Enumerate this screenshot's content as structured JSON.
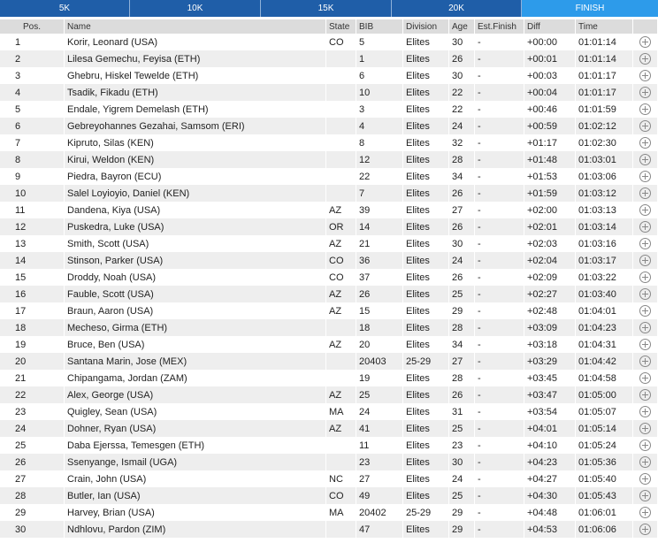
{
  "tabs": [
    {
      "label": "5K",
      "active": false
    },
    {
      "label": "10K",
      "active": false
    },
    {
      "label": "15K",
      "active": false
    },
    {
      "label": "20K",
      "active": false
    },
    {
      "label": "FINISH",
      "active": true
    }
  ],
  "columns": [
    "Pos.",
    "Name",
    "State",
    "BIB",
    "Division",
    "Age",
    "Est.Finish",
    "Diff",
    "Time",
    ""
  ],
  "rows": [
    [
      "1",
      "Korir, Leonard (USA)",
      "CO",
      "5",
      "Elites",
      "30",
      "-",
      "+00:00",
      "01:01:14"
    ],
    [
      "2",
      "Lilesa Gemechu, Feyisa (ETH)",
      "",
      "1",
      "Elites",
      "26",
      "-",
      "+00:01",
      "01:01:14"
    ],
    [
      "3",
      "Ghebru, Hiskel Tewelde (ETH)",
      "",
      "6",
      "Elites",
      "30",
      "-",
      "+00:03",
      "01:01:17"
    ],
    [
      "4",
      "Tsadik, Fikadu (ETH)",
      "",
      "10",
      "Elites",
      "22",
      "-",
      "+00:04",
      "01:01:17"
    ],
    [
      "5",
      "Endale, Yigrem Demelash (ETH)",
      "",
      "3",
      "Elites",
      "22",
      "-",
      "+00:46",
      "01:01:59"
    ],
    [
      "6",
      "Gebreyohannes Gezahai, Samsom (ERI)",
      "",
      "4",
      "Elites",
      "24",
      "-",
      "+00:59",
      "01:02:12"
    ],
    [
      "7",
      "Kipruto, Silas (KEN)",
      "",
      "8",
      "Elites",
      "32",
      "-",
      "+01:17",
      "01:02:30"
    ],
    [
      "8",
      "Kirui, Weldon (KEN)",
      "",
      "12",
      "Elites",
      "28",
      "-",
      "+01:48",
      "01:03:01"
    ],
    [
      "9",
      "Piedra, Bayron (ECU)",
      "",
      "22",
      "Elites",
      "34",
      "-",
      "+01:53",
      "01:03:06"
    ],
    [
      "10",
      "Salel Loyioyio, Daniel (KEN)",
      "",
      "7",
      "Elites",
      "26",
      "-",
      "+01:59",
      "01:03:12"
    ],
    [
      "11",
      "Dandena, Kiya (USA)",
      "AZ",
      "39",
      "Elites",
      "27",
      "-",
      "+02:00",
      "01:03:13"
    ],
    [
      "12",
      "Puskedra, Luke (USA)",
      "OR",
      "14",
      "Elites",
      "26",
      "-",
      "+02:01",
      "01:03:14"
    ],
    [
      "13",
      "Smith, Scott (USA)",
      "AZ",
      "21",
      "Elites",
      "30",
      "-",
      "+02:03",
      "01:03:16"
    ],
    [
      "14",
      "Stinson, Parker (USA)",
      "CO",
      "36",
      "Elites",
      "24",
      "-",
      "+02:04",
      "01:03:17"
    ],
    [
      "15",
      "Droddy, Noah (USA)",
      "CO",
      "37",
      "Elites",
      "26",
      "-",
      "+02:09",
      "01:03:22"
    ],
    [
      "16",
      "Fauble, Scott (USA)",
      "AZ",
      "26",
      "Elites",
      "25",
      "-",
      "+02:27",
      "01:03:40"
    ],
    [
      "17",
      "Braun, Aaron (USA)",
      "AZ",
      "15",
      "Elites",
      "29",
      "-",
      "+02:48",
      "01:04:01"
    ],
    [
      "18",
      "Mecheso, Girma (ETH)",
      "",
      "18",
      "Elites",
      "28",
      "-",
      "+03:09",
      "01:04:23"
    ],
    [
      "19",
      "Bruce, Ben (USA)",
      "AZ",
      "20",
      "Elites",
      "34",
      "-",
      "+03:18",
      "01:04:31"
    ],
    [
      "20",
      "Santana Marin, Jose (MEX)",
      "",
      "20403",
      "25-29",
      "27",
      "-",
      "+03:29",
      "01:04:42"
    ],
    [
      "21",
      "Chipangama, Jordan (ZAM)",
      "",
      "19",
      "Elites",
      "28",
      "-",
      "+03:45",
      "01:04:58"
    ],
    [
      "22",
      "Alex, George (USA)",
      "AZ",
      "25",
      "Elites",
      "26",
      "-",
      "+03:47",
      "01:05:00"
    ],
    [
      "23",
      "Quigley, Sean (USA)",
      "MA",
      "24",
      "Elites",
      "31",
      "-",
      "+03:54",
      "01:05:07"
    ],
    [
      "24",
      "Dohner, Ryan (USA)",
      "AZ",
      "41",
      "Elites",
      "25",
      "-",
      "+04:01",
      "01:05:14"
    ],
    [
      "25",
      "Daba Ejerssa, Temesgen (ETH)",
      "",
      "11",
      "Elites",
      "23",
      "-",
      "+04:10",
      "01:05:24"
    ],
    [
      "26",
      "Ssenyange, Ismail (UGA)",
      "",
      "23",
      "Elites",
      "30",
      "-",
      "+04:23",
      "01:05:36"
    ],
    [
      "27",
      "Crain, John (USA)",
      "NC",
      "27",
      "Elites",
      "24",
      "-",
      "+04:27",
      "01:05:40"
    ],
    [
      "28",
      "Butler, Ian (USA)",
      "CO",
      "49",
      "Elites",
      "25",
      "-",
      "+04:30",
      "01:05:43"
    ],
    [
      "29",
      "Harvey, Brian (USA)",
      "MA",
      "20402",
      "25-29",
      "29",
      "-",
      "+04:48",
      "01:06:01"
    ],
    [
      "30",
      "Ndhlovu, Pardon (ZIM)",
      "",
      "47",
      "Elites",
      "29",
      "-",
      "+04:53",
      "01:06:06"
    ]
  ]
}
